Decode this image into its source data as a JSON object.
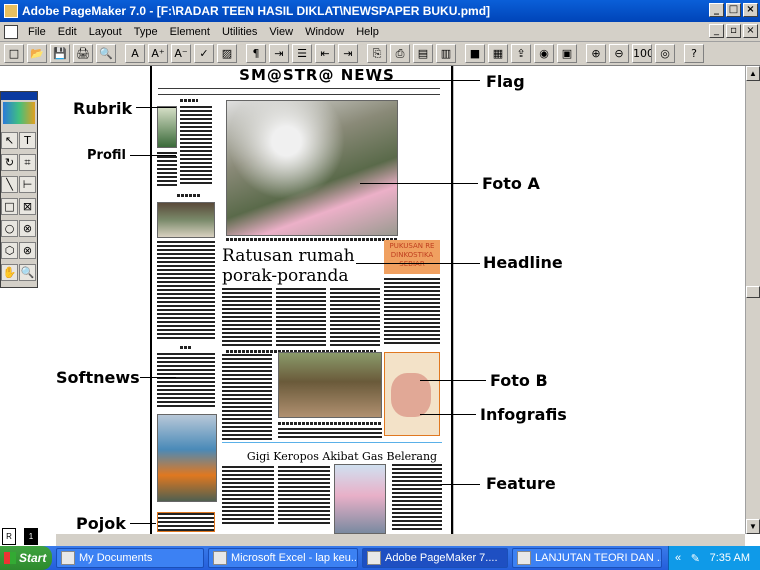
{
  "window": {
    "title": "Adobe PageMaker 7.0 - [F:\\RADAR TEEN HASIL DIKLAT\\NEWSPAPER BUKU.pmd]"
  },
  "menu": [
    "File",
    "Edit",
    "Layout",
    "Type",
    "Element",
    "Utilities",
    "View",
    "Window",
    "Help"
  ],
  "toolbar_icons": [
    "new-icon",
    "open-icon",
    "save-icon",
    "print-icon",
    "find-icon",
    "font-A-icon",
    "font-larger-icon",
    "font-smaller-icon",
    "spellcheck-icon",
    "fill-icon",
    "paragraph-icon",
    "indent-icon",
    "bullets-icon",
    "outdent-icon",
    "indent-right-icon",
    "copy-icon",
    "paste-icon",
    "place-icon",
    "story-icon",
    "color-icon",
    "image-icon",
    "export-icon",
    "globe-icon",
    "pdf-icon",
    "zoom-in-icon",
    "zoom-out-icon",
    "actual-size-icon",
    "fit-icon",
    "help-icon"
  ],
  "toolbar_glyphs": [
    "□",
    "📂",
    "💾",
    "🖨",
    "🔍",
    "A",
    "A⁺",
    "A⁻",
    "✓",
    "▨",
    "¶",
    "⇥",
    "☰",
    "⇤",
    "⇥",
    "⎘",
    "⎙",
    "▤",
    "▥",
    "■",
    "▦",
    "⇪",
    "◉",
    "▣",
    "⊕",
    "⊖",
    "100",
    "◎",
    "?"
  ],
  "newspaper": {
    "flag": "SM@STR@ NEWS",
    "headline": "Ratusan rumah porak-poranda",
    "feature_title": "Gigi Keropos Akibat Gas Belerang",
    "pullquote": "PUKUSAN RE DINKOSTIKA SEBIAR"
  },
  "annotations": {
    "flag": "Flag",
    "rubrik": "Rubrik",
    "profil": "Profil",
    "foto_a": "Foto A",
    "headline": "Headline",
    "softnews": "Softnews",
    "foto_b": "Foto B",
    "infografis": "Infografis",
    "feature": "Feature",
    "pojok": "Pojok"
  },
  "taskbar": {
    "start": "Start",
    "tasks": [
      "My Documents",
      "Microsoft Excel - lap keu...",
      "Adobe PageMaker 7....",
      "LANJUTAN TEORI DAN ..."
    ],
    "time": "7:35 AM"
  },
  "colors": {
    "title_bar": "#0a5fd8",
    "taskbar": "#245edb",
    "start": "#3fa33f",
    "infographic": "#f0a060"
  }
}
